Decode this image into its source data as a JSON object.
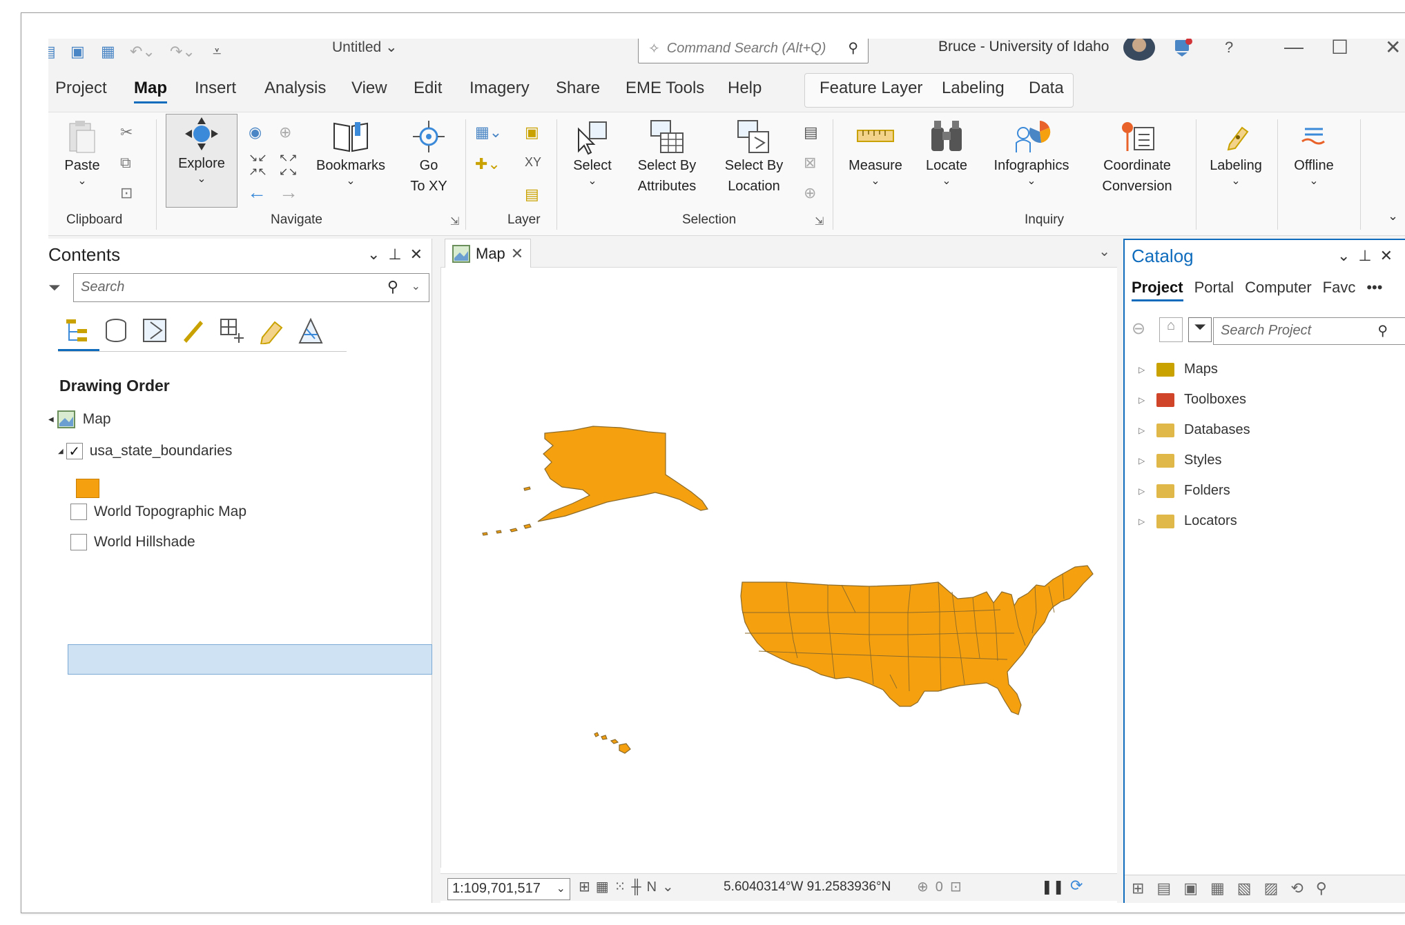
{
  "titlebar": {
    "doc_title": "Untitled",
    "command_search_placeholder": "Command Search (Alt+Q)",
    "user": "Bruce - University of Idaho"
  },
  "tabs": [
    "Project",
    "Map",
    "Insert",
    "Analysis",
    "View",
    "Edit",
    "Imagery",
    "Share",
    "EME Tools",
    "Help"
  ],
  "active_tab": "Map",
  "context_tabs": [
    "Feature Layer",
    "Labeling",
    "Data"
  ],
  "ribbon": {
    "paste": "Paste",
    "explore": "Explore",
    "bookmarks": "Bookmarks",
    "go_to_xy_1": "Go",
    "go_to_xy_2": "To XY",
    "select": "Select",
    "select_attr_1": "Select By",
    "select_attr_2": "Attributes",
    "select_loc_1": "Select By",
    "select_loc_2": "Location",
    "measure": "Measure",
    "locate": "Locate",
    "infographics": "Infographics",
    "coord_1": "Coordinate",
    "coord_2": "Conversion",
    "labeling": "Labeling",
    "offline": "Offline",
    "groups": {
      "clipboard": "Clipboard",
      "navigate": "Navigate",
      "layer": "Layer",
      "selection": "Selection",
      "inquiry": "Inquiry"
    }
  },
  "contents": {
    "title": "Contents",
    "search_placeholder": "Search",
    "drawing_order": "Drawing Order",
    "map_item": "Map",
    "layers": [
      {
        "name": "usa_state_boundaries",
        "checked": true
      },
      {
        "name": "World Topographic Map",
        "checked": false
      },
      {
        "name": "World Hillshade",
        "checked": false
      }
    ],
    "symbol_color": "#f5a00f"
  },
  "mapview": {
    "tab_label": "Map",
    "scale": "1:109,701,517",
    "coordinates": "5.6040314°W 91.2583936°N"
  },
  "catalog": {
    "title": "Catalog",
    "tabs": [
      "Project",
      "Portal",
      "Computer",
      "Favc"
    ],
    "more": "•••",
    "search_placeholder": "Search Project",
    "items": [
      "Maps",
      "Toolboxes",
      "Databases",
      "Styles",
      "Folders",
      "Locators"
    ]
  },
  "colors": {
    "accent": "#0f6cbd",
    "state_fill": "#f5a00f",
    "state_stroke": "#8a6a2a"
  }
}
